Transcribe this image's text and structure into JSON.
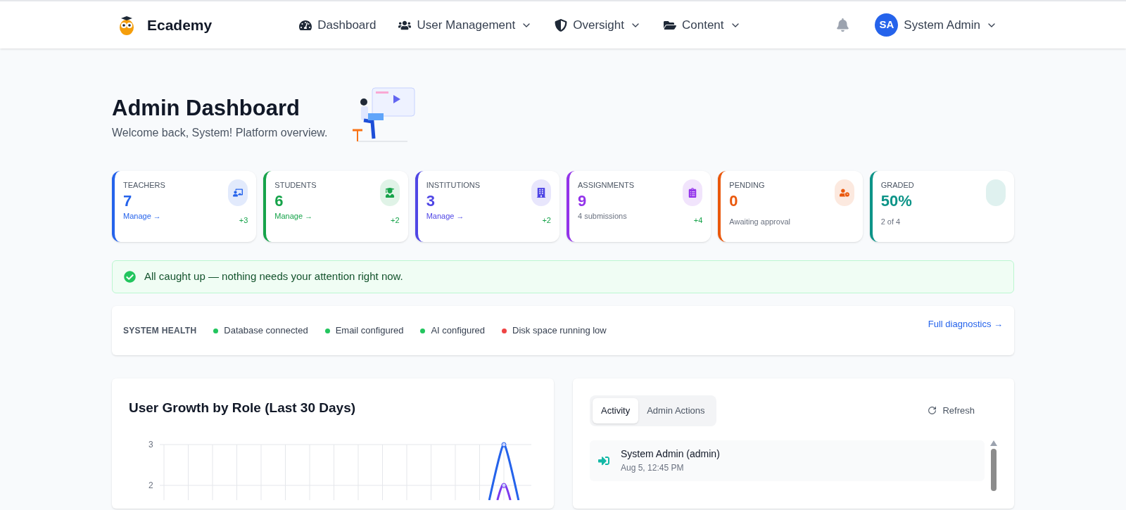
{
  "brand": {
    "name": "Ecademy"
  },
  "nav": [
    {
      "label": "Dashboard",
      "dropdown": false
    },
    {
      "label": "User Management",
      "dropdown": true
    },
    {
      "label": "Oversight",
      "dropdown": true
    },
    {
      "label": "Content",
      "dropdown": true
    }
  ],
  "user": {
    "initials": "SA",
    "name": "System Admin"
  },
  "header": {
    "title": "Admin Dashboard",
    "subtitle": "Welcome back, System! Platform overview."
  },
  "stats": [
    {
      "label": "TEACHERS",
      "value": "7",
      "link": "Manage →",
      "delta": "+3",
      "color": "#2563eb"
    },
    {
      "label": "STUDENTS",
      "value": "6",
      "link": "Manage →",
      "delta": "+2",
      "color": "#16a34a"
    },
    {
      "label": "INSTITUTIONS",
      "value": "3",
      "link": "Manage →",
      "delta": "+2",
      "color": "#4f46e5"
    },
    {
      "label": "ASSIGNMENTS",
      "value": "9",
      "note": "4 submissions",
      "delta": "+4",
      "color": "#9333ea"
    },
    {
      "label": "PENDING",
      "value": "0",
      "note": "Awaiting approval",
      "color": "#ea580c"
    },
    {
      "label": "GRADED",
      "value": "50%",
      "note": "2 of 4",
      "color": "#0d9488"
    }
  ],
  "alert": {
    "text": "All caught up — nothing needs your attention right now."
  },
  "health": {
    "title": "SYSTEM HEALTH",
    "items": [
      {
        "label": "Database connected",
        "color": "#22c55e"
      },
      {
        "label": "Email configured",
        "color": "#22c55e"
      },
      {
        "label": "AI configured",
        "color": "#22c55e"
      },
      {
        "label": "Disk space running low",
        "color": "#ef4444"
      }
    ],
    "link": "Full diagnostics →"
  },
  "growth": {
    "title": "User Growth by Role (Last 30 Days)",
    "y_ticks": [
      "3",
      "2"
    ]
  },
  "activity": {
    "tabs": [
      {
        "label": "Activity",
        "selected": true
      },
      {
        "label": "Admin Actions",
        "selected": false
      }
    ],
    "refresh": "Refresh",
    "items": [
      {
        "title": "System Admin (admin)",
        "time": "Aug 5, 12:45 PM"
      }
    ]
  }
}
